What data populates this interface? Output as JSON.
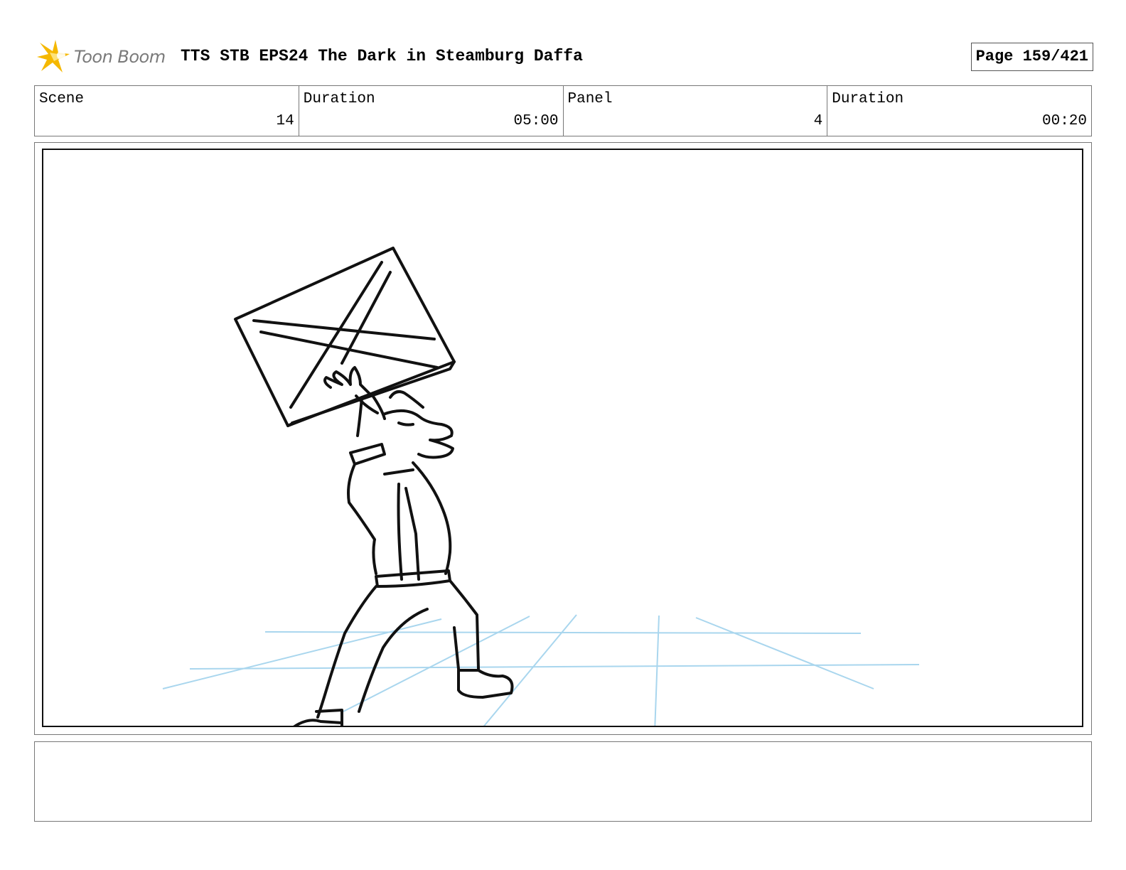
{
  "header": {
    "logo_text": "Toon Boom",
    "title": "TTS STB EPS24 The Dark in Steamburg Daffa",
    "page": "Page 159/421"
  },
  "info": {
    "scene_label": "Scene",
    "scene_value": "14",
    "scene_duration_label": "Duration",
    "scene_duration_value": "05:00",
    "panel_label": "Panel",
    "panel_value": "4",
    "panel_duration_label": "Duration",
    "panel_duration_value": "00:20"
  },
  "colors": {
    "logo_star": "#f5b800",
    "guide_lines": "#a9d6ee"
  },
  "icons": {
    "logo": "toon-boom-star-icon"
  },
  "notes": {
    "text": ""
  }
}
